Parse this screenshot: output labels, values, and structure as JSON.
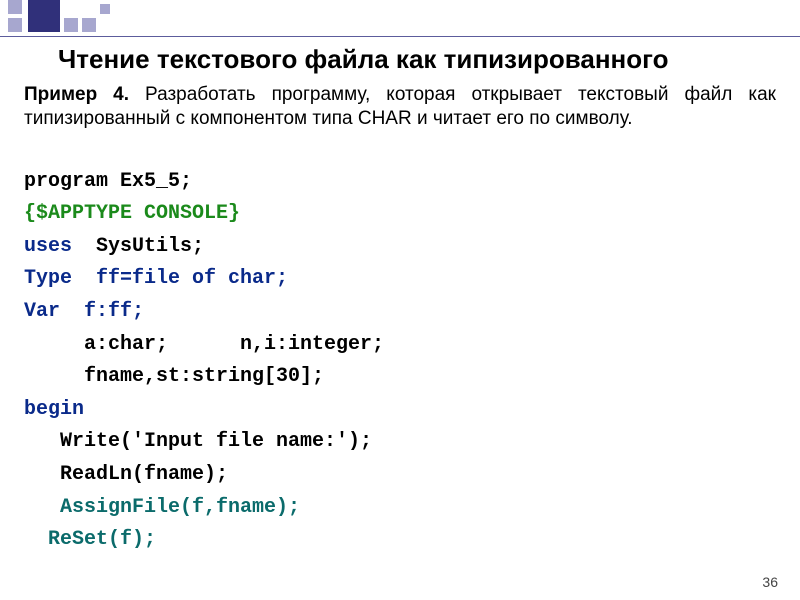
{
  "header": {
    "title": "Чтение текстового файла как типизированного"
  },
  "example": {
    "label": "Пример 4.",
    "text": "Разработать программу, которая открывает текстовый файл как типизированный с компонентом типа CHAR и читает его по символу."
  },
  "code": {
    "l1": "program Ex5_5;",
    "l2": "{$APPTYPE CONSOLE}",
    "l3a": "uses",
    "l3b": "  SysUtils;",
    "l4a": "Type",
    "l4b": "  ff=file of char;",
    "l5a": "Var",
    "l5b": "  f:ff;",
    "l6": "     a:char;      n,i:integer;",
    "l7": "     fname,st:string[30];",
    "l8": "begin",
    "l9": "   Write('Input file name:');",
    "l10": "   ReadLn(fname);",
    "l11a": "   ",
    "l11b": "AssignFile(f,fname);",
    "l12a": "  ",
    "l12b": "ReSet(f);"
  },
  "page": {
    "number": "36"
  }
}
